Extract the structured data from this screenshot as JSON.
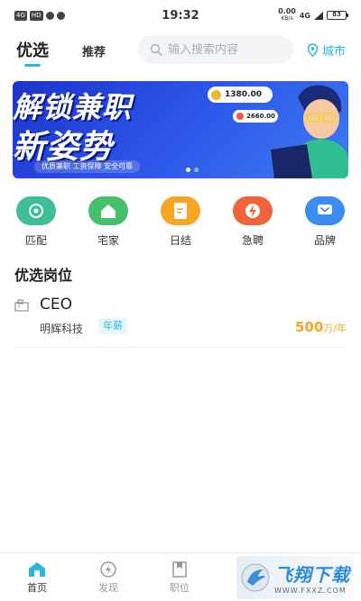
{
  "status_bar": {
    "signal_chip": "4G",
    "hd_chip": "HD",
    "time": "19:32",
    "speed": "0.00",
    "speed_unit": "KB/s",
    "network": "4G",
    "battery": "83"
  },
  "top_nav": {
    "tab_active": "优选",
    "tab_other": "推荐",
    "search_placeholder": "输入搜索内容",
    "city_label": "城市"
  },
  "banner": {
    "line1": "解锁兼职",
    "line2": "新姿势",
    "tagline": "优质兼职  工资保障  安全可靠",
    "amount1": "1380.00",
    "amount2": "2660.00"
  },
  "categories": [
    {
      "label": "匹配",
      "color": "#3dbf9a",
      "icon": "target-icon"
    },
    {
      "label": "宅家",
      "color": "#45c06a",
      "icon": "home-icon"
    },
    {
      "label": "日结",
      "color": "#f6a623",
      "icon": "document-icon"
    },
    {
      "label": "急聘",
      "color": "#f0643a",
      "icon": "flash-icon"
    },
    {
      "label": "品牌",
      "color": "#3b8bf0",
      "icon": "chevron-heart-icon"
    }
  ],
  "section_title": "优选岗位",
  "job": {
    "title": "CEO",
    "company": "明辉科技",
    "tag": "年薪",
    "salary_value": "500",
    "salary_unit": "万/年"
  },
  "bottom_tabs": [
    {
      "label": "首页",
      "icon": "home-icon",
      "active": true
    },
    {
      "label": "发现",
      "icon": "compass-icon",
      "active": false
    },
    {
      "label": "职位",
      "icon": "bookmark-icon",
      "active": false
    }
  ],
  "watermark": {
    "cn": "飞翔下载",
    "url": "WWW.FXXZ.COM"
  },
  "colors": {
    "accent": "#2bb6e0",
    "salary": "#f5a623",
    "banner_blue": "#2b53e8"
  }
}
